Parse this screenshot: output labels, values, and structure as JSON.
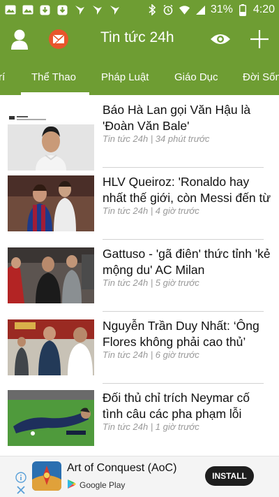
{
  "status_bar": {
    "battery_percent": "31%",
    "time": "4:20",
    "icons": [
      "image-icon",
      "image-icon",
      "download-icon",
      "download-icon",
      "brand-icon",
      "brand-icon",
      "brand-icon",
      "bluetooth-icon",
      "alarm-icon",
      "wifi-icon",
      "signal-icon",
      "battery-icon"
    ]
  },
  "app_bar": {
    "title": "Tin tức 24h",
    "left_icons": [
      "user-icon",
      "mail-icon"
    ],
    "right_icons": [
      "eye-icon",
      "plus-icon"
    ],
    "color": "#6e9d33"
  },
  "tabs": {
    "items": [
      {
        "label": "rí"
      },
      {
        "label": "Thể Thao",
        "selected": true
      },
      {
        "label": "Pháp Luật"
      },
      {
        "label": "Giáo Dục"
      },
      {
        "label": "Đời Sốn"
      }
    ]
  },
  "news": [
    {
      "title": "Báo Hà Lan gọi Văn Hậu là 'Đoàn Văn Bale'",
      "meta": "Tin tức 24h | 34 phút trước"
    },
    {
      "title": "HLV Queiroz: 'Ronaldo hay nhất thế giới, còn Messi đến từ",
      "meta": "Tin tức 24h | 4 giờ trước"
    },
    {
      "title": "Gattuso - 'gã điên' thức tỉnh 'kẻ mộng du' AC Milan",
      "meta": "Tin tức 24h | 5 giờ trước"
    },
    {
      "title": "Nguyễn Trần Duy Nhất: ‘Ông Flores không phải cao thủ’",
      "meta": "Tin tức 24h | 6 giờ trước"
    },
    {
      "title": "Đối thủ chỉ trích Neymar cố tình câu các pha phạm lỗi",
      "meta": "Tin tức 24h | 1 giờ trước"
    }
  ],
  "ad": {
    "title": "Art of Conquest (AoC)",
    "store": "Google Play",
    "install_label": "INSTALL"
  }
}
